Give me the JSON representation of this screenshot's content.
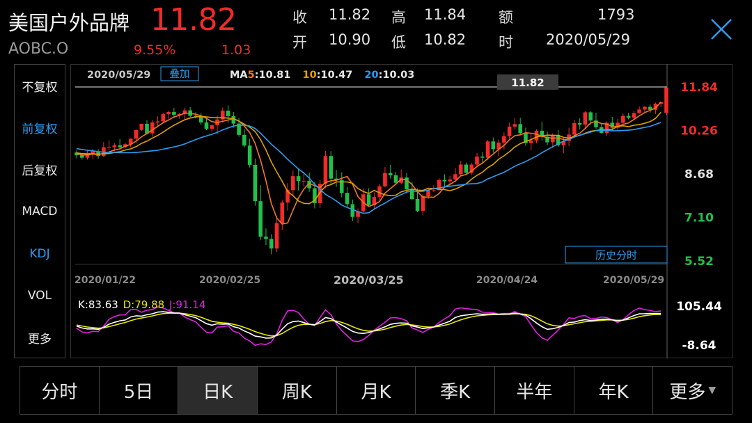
{
  "header": {
    "name": "美国户外品牌",
    "price": "11.82",
    "code": "AOBC.O",
    "change_pct": "9.55%",
    "change": "1.03",
    "stats": {
      "close_label": "收",
      "close": "11.82",
      "high_label": "高",
      "high": "11.84",
      "amount_label": "额",
      "amount": "1793",
      "open_label": "开",
      "open": "10.90",
      "low_label": "低",
      "low": "10.82",
      "time_label": "时",
      "date": "2020/05/29"
    }
  },
  "side_menu": {
    "items": [
      {
        "label": "不复权",
        "active": false
      },
      {
        "label": "前复权",
        "active": true
      },
      {
        "label": "后复权",
        "active": false
      },
      {
        "label": "MACD",
        "active": false
      },
      {
        "label": "KDJ",
        "active": true
      },
      {
        "label": "VOL",
        "active": false
      },
      {
        "label": "更多",
        "active": false
      }
    ]
  },
  "chart_data": {
    "type": "candlestick",
    "info_date": "2020/05/29",
    "overlay_button": "叠加",
    "ma": {
      "prefix": "MA",
      "items": [
        {
          "period": "5",
          "value": "10.81",
          "color": "#f07820"
        },
        {
          "period": "10",
          "value": "10.47",
          "color": "#e0a000"
        },
        {
          "period": "20",
          "value": "10.03",
          "color": "#2d9cf0"
        }
      ]
    },
    "price_axis": {
      "ticks": [
        "11.84",
        "10.26",
        "8.68",
        "7.10",
        "5.52"
      ],
      "tick_colors": [
        "#f42a2a",
        "#f42a2a",
        "#e0e0e0",
        "#22c04a",
        "#22c04a"
      ],
      "range": [
        5.52,
        11.84
      ]
    },
    "current_price_label": "11.82",
    "history_button": "历史分时",
    "date_labels": [
      "2020/01/22",
      "2020/02/25",
      "2020/03/25",
      "2020/04/24",
      "2020/05/29"
    ],
    "kdj": {
      "k_label": "K:83.63",
      "d_label": "D:79.88",
      "j_label": "J:91.14",
      "axis_ticks": [
        "105.44",
        "-8.64"
      ],
      "range": [
        -8.64,
        105.44
      ],
      "colors": {
        "K": "#ffffff",
        "D": "#e8e800",
        "J": "#e020e0"
      }
    },
    "colors": {
      "up": "#f42a2a",
      "down": "#22c04a"
    },
    "candles": [
      [
        9.46,
        9.55,
        9.25,
        9.36
      ],
      [
        9.36,
        9.43,
        9.2,
        9.27
      ],
      [
        9.27,
        9.56,
        9.2,
        9.42
      ],
      [
        9.42,
        9.59,
        9.24,
        9.5
      ],
      [
        9.5,
        9.58,
        9.23,
        9.33
      ],
      [
        9.33,
        9.84,
        9.29,
        9.65
      ],
      [
        9.65,
        9.9,
        9.53,
        9.65
      ],
      [
        9.65,
        9.79,
        9.5,
        9.72
      ],
      [
        9.72,
        9.95,
        9.6,
        9.65
      ],
      [
        9.65,
        9.81,
        9.62,
        9.76
      ],
      [
        9.76,
        9.97,
        9.66,
        9.96
      ],
      [
        9.96,
        10.29,
        9.82,
        10.28
      ],
      [
        10.28,
        10.51,
        10.24,
        10.5
      ],
      [
        10.5,
        10.63,
        10.11,
        10.15
      ],
      [
        10.15,
        10.64,
        10.03,
        10.55
      ],
      [
        10.55,
        10.77,
        10.42,
        10.59
      ],
      [
        10.59,
        10.91,
        10.54,
        10.85
      ],
      [
        10.85,
        10.98,
        10.69,
        10.93
      ],
      [
        10.93,
        11.08,
        10.71,
        10.83
      ],
      [
        10.83,
        10.9,
        10.69,
        10.86
      ],
      [
        10.86,
        11.09,
        10.65,
        10.99
      ],
      [
        10.99,
        11.11,
        10.74,
        10.79
      ],
      [
        10.79,
        10.92,
        10.7,
        10.77
      ],
      [
        10.77,
        10.89,
        10.46,
        10.55
      ],
      [
        10.55,
        10.68,
        10.27,
        10.32
      ],
      [
        10.32,
        10.47,
        10.22,
        10.45
      ],
      [
        10.45,
        10.8,
        10.13,
        10.66
      ],
      [
        10.66,
        11.09,
        10.54,
        10.98
      ],
      [
        10.98,
        11.17,
        10.54,
        10.78
      ],
      [
        10.78,
        10.93,
        10.36,
        10.51
      ],
      [
        10.51,
        10.71,
        10.03,
        10.1
      ],
      [
        10.1,
        10.31,
        9.64,
        9.71
      ],
      [
        9.71,
        9.96,
        8.91,
        9.01
      ],
      [
        9.01,
        9.24,
        7.53,
        7.69
      ],
      [
        7.69,
        8.27,
        6.27,
        6.4
      ],
      [
        6.4,
        6.7,
        6.1,
        6.32
      ],
      [
        6.32,
        6.49,
        5.76,
        5.97
      ],
      [
        5.97,
        7.14,
        5.85,
        6.89
      ],
      [
        6.89,
        7.73,
        6.64,
        7.64
      ],
      [
        7.64,
        8.35,
        7.35,
        8.09
      ],
      [
        8.09,
        8.81,
        7.89,
        8.6
      ],
      [
        8.6,
        8.86,
        8.08,
        8.42
      ],
      [
        8.42,
        8.76,
        8.24,
        8.43
      ],
      [
        8.43,
        8.73,
        8.03,
        8.16
      ],
      [
        8.16,
        8.38,
        7.43,
        7.62
      ],
      [
        7.62,
        8.47,
        7.45,
        8.32
      ],
      [
        8.32,
        9.52,
        8.16,
        9.33
      ],
      [
        9.33,
        9.51,
        8.28,
        8.51
      ],
      [
        8.51,
        8.83,
        8.21,
        8.46
      ],
      [
        8.46,
        8.74,
        7.83,
        7.99
      ],
      [
        7.99,
        8.2,
        7.46,
        7.58
      ],
      [
        7.58,
        7.75,
        6.96,
        7.12
      ],
      [
        7.12,
        7.43,
        6.91,
        7.32
      ],
      [
        7.32,
        8.16,
        7.28,
        7.94
      ],
      [
        7.94,
        8.16,
        7.49,
        7.55
      ],
      [
        7.55,
        8.01,
        7.39,
        7.84
      ],
      [
        7.84,
        8.32,
        7.73,
        8.23
      ],
      [
        8.23,
        8.93,
        8.19,
        8.71
      ],
      [
        8.71,
        9.01,
        8.51,
        8.63
      ],
      [
        8.63,
        8.75,
        8.33,
        8.36
      ],
      [
        8.36,
        8.84,
        8.31,
        8.55
      ],
      [
        8.55,
        8.71,
        7.98,
        8.12
      ],
      [
        8.12,
        8.4,
        7.72,
        7.77
      ],
      [
        7.77,
        8.15,
        7.29,
        7.34
      ],
      [
        7.34,
        7.96,
        7.17,
        7.87
      ],
      [
        7.87,
        8.14,
        7.77,
        8.08
      ],
      [
        8.08,
        8.27,
        8.03,
        8.09
      ],
      [
        8.09,
        8.52,
        8.07,
        8.46
      ],
      [
        8.46,
        8.67,
        8.23,
        8.41
      ],
      [
        8.41,
        8.62,
        8.22,
        8.48
      ],
      [
        8.48,
        8.9,
        8.38,
        8.67
      ],
      [
        8.67,
        9.15,
        8.61,
        9.02
      ],
      [
        9.02,
        9.1,
        8.66,
        8.72
      ],
      [
        8.72,
        9.08,
        8.64,
        9.02
      ],
      [
        9.02,
        9.44,
        8.97,
        9.31
      ],
      [
        9.31,
        9.48,
        9.06,
        9.27
      ],
      [
        9.27,
        9.92,
        9.19,
        9.86
      ],
      [
        9.86,
        10.0,
        9.45,
        9.58
      ],
      [
        9.58,
        9.93,
        9.34,
        9.82
      ],
      [
        9.82,
        10.19,
        9.57,
        10.05
      ],
      [
        10.05,
        10.55,
        9.96,
        10.4
      ],
      [
        10.4,
        10.71,
        10.29,
        10.49
      ],
      [
        10.49,
        10.72,
        10.1,
        10.16
      ],
      [
        10.16,
        10.36,
        9.7,
        9.8
      ],
      [
        9.8,
        10.12,
        9.53,
        9.89
      ],
      [
        9.89,
        10.3,
        9.79,
        10.25
      ],
      [
        10.25,
        10.58,
        9.89,
        10.03
      ],
      [
        10.03,
        10.22,
        9.73,
        9.83
      ],
      [
        9.83,
        10.16,
        9.62,
        10.1
      ],
      [
        10.1,
        10.27,
        9.67,
        9.72
      ],
      [
        9.72,
        9.99,
        9.43,
        9.88
      ],
      [
        9.88,
        10.36,
        9.69,
        10.11
      ],
      [
        10.11,
        10.65,
        10.01,
        10.53
      ],
      [
        10.53,
        10.7,
        10.29,
        10.47
      ],
      [
        10.47,
        10.96,
        10.37,
        10.92
      ],
      [
        10.92,
        10.97,
        10.47,
        10.62
      ],
      [
        10.62,
        10.9,
        10.32,
        10.38
      ],
      [
        10.38,
        10.54,
        10.14,
        10.17
      ],
      [
        10.17,
        10.59,
        10.06,
        10.54
      ],
      [
        10.54,
        10.75,
        10.26,
        10.36
      ],
      [
        10.36,
        10.69,
        10.27,
        10.54
      ],
      [
        10.54,
        10.88,
        10.47,
        10.79
      ],
      [
        10.79,
        10.9,
        10.66,
        10.72
      ],
      [
        10.72,
        10.98,
        10.67,
        10.89
      ],
      [
        10.89,
        11.13,
        10.86,
        11.02
      ],
      [
        11.02,
        11.14,
        10.92,
        11.12
      ],
      [
        11.12,
        11.21,
        10.9,
        11.01
      ],
      [
        11.01,
        11.27,
        10.86,
        11.23
      ],
      [
        11.23,
        11.3,
        11.11,
        11.29
      ],
      [
        10.9,
        11.84,
        10.82,
        11.82
      ]
    ],
    "ma5": [
      9.42,
      9.37,
      9.37,
      9.4,
      9.38,
      9.43,
      9.48,
      9.55,
      9.59,
      9.69,
      9.75,
      9.87,
      10.03,
      10.15,
      10.28,
      10.41,
      10.54,
      10.64,
      10.75,
      10.81,
      10.89,
      10.88,
      10.85,
      10.79,
      10.7,
      10.58,
      10.55,
      10.59,
      10.64,
      10.68,
      10.61,
      10.42,
      10.18,
      9.79,
      9.18,
      8.43,
      7.6,
      7.08,
      6.86,
      6.9,
      7.36,
      7.81,
      8.13,
      8.34,
      8.25,
      8.19,
      8.37,
      8.43,
      8.45,
      8.52,
      8.59,
      8.31,
      7.86,
      7.64,
      7.5,
      7.57,
      7.68,
      7.98,
      8.15,
      8.31,
      8.49,
      8.47,
      8.29,
      8.03,
      7.84,
      7.84,
      7.83,
      7.97,
      8.2,
      8.3,
      8.42,
      8.61,
      8.66,
      8.78,
      8.95,
      9.07,
      9.24,
      9.4,
      9.57,
      9.72,
      9.92,
      10.07,
      10.1,
      10.18,
      10.16,
      10.12,
      10.05,
      10.0,
      9.98,
      9.99,
      9.93,
      9.93,
      10.07,
      10.16,
      10.33,
      10.53,
      10.59,
      10.51,
      10.49,
      10.41,
      10.4,
      10.48,
      10.53,
      10.66,
      10.79,
      10.91,
      10.99,
      11.08,
      11.29
    ],
    "ma10": [
      9.44,
      9.42,
      9.41,
      9.41,
      9.4,
      9.41,
      9.42,
      9.46,
      9.49,
      9.55,
      9.59,
      9.67,
      9.79,
      9.87,
      9.98,
      10.08,
      10.2,
      10.33,
      10.45,
      10.55,
      10.65,
      10.71,
      10.75,
      10.77,
      10.75,
      10.73,
      10.72,
      10.72,
      10.71,
      10.69,
      10.6,
      10.49,
      10.38,
      10.22,
      9.93,
      9.55,
      9.11,
      8.75,
      8.41,
      8.04,
      7.89,
      7.7,
      7.61,
      7.6,
      7.72,
      8.01,
      8.23,
      8.29,
      8.39,
      8.39,
      8.39,
      8.34,
      8.15,
      8.04,
      7.97,
      8.08,
      7.99,
      7.92,
      7.89,
      7.91,
      8.03,
      8.08,
      8.13,
      8.09,
      8.08,
      8.16,
      8.15,
      8.13,
      8.11,
      8.07,
      8.13,
      8.22,
      8.32,
      8.49,
      8.63,
      8.74,
      8.91,
      9.03,
      9.21,
      9.34,
      9.49,
      9.66,
      9.78,
      9.86,
      9.93,
      10.02,
      10.06,
      10.09,
      10.08,
      10.08,
      10.01,
      9.98,
      10.04,
      10.08,
      10.16,
      10.23,
      10.26,
      10.29,
      10.28,
      10.3,
      10.41,
      10.43,
      10.4,
      10.45,
      10.47,
      10.52,
      10.58,
      10.7,
      10.92
    ],
    "ma20": [
      9.6,
      9.57,
      9.54,
      9.52,
      9.49,
      9.47,
      9.46,
      9.46,
      9.45,
      9.45,
      9.45,
      9.46,
      9.48,
      9.5,
      9.52,
      9.54,
      9.58,
      9.62,
      9.66,
      9.71,
      9.77,
      9.85,
      9.93,
      10.0,
      10.06,
      10.12,
      10.19,
      10.28,
      10.35,
      10.42,
      10.45,
      10.45,
      10.42,
      10.33,
      10.16,
      9.96,
      9.76,
      9.59,
      9.41,
      9.21,
      9.04,
      8.86,
      8.71,
      8.53,
      8.3,
      8.12,
      7.94,
      7.82,
      7.7,
      7.55,
      7.46,
      7.39,
      7.31,
      7.25,
      7.27,
      7.4,
      7.52,
      7.62,
      7.74,
      7.84,
      7.93,
      8.02,
      8.06,
      8.04,
      8.05,
      8.09,
      8.15,
      8.17,
      8.21,
      8.23,
      8.26,
      8.28,
      8.31,
      8.32,
      8.33,
      8.39,
      8.5,
      8.58,
      8.66,
      8.74,
      8.85,
      8.96,
      9.05,
      9.13,
      9.23,
      9.33,
      9.45,
      9.56,
      9.67,
      9.77,
      9.87,
      9.93,
      10.02,
      10.09,
      10.14,
      10.2,
      10.25,
      10.27,
      10.26,
      10.25,
      10.25,
      10.26,
      10.27,
      10.29,
      10.33,
      10.37,
      10.41,
      10.48,
      10.55
    ],
    "k": [
      45.95,
      40.27,
      37.33,
      37.68,
      36.22,
      42.25,
      51.55,
      57.13,
      61.65,
      64.19,
      73.08,
      76.53,
      75.48,
      79.78,
      82.58,
      87.69,
      88.67,
      87.13,
      84.92,
      84.73,
      79.56,
      75.32,
      71.02,
      62.38,
      53.18,
      48.6,
      52.78,
      51.77,
      52.04,
      44.19,
      40.07,
      31.35,
      24.59,
      15.97,
      13.82,
      9.95,
      10.56,
      19.32,
      37.08,
      52.88,
      59.17,
      61.12,
      56.24,
      51.37,
      49.4,
      59.58,
      71.12,
      68.25,
      58.25,
      48.78,
      39.93,
      30.14,
      25.09,
      24.16,
      26.62,
      32.05,
      37.43,
      43.55,
      51.11,
      54.22,
      55.33,
      54.54,
      46.28,
      42.9,
      38.47,
      40.8,
      43.17,
      48.82,
      54.46,
      60.66,
      71.38,
      76.52,
      78.86,
      80.91,
      82.67,
      81.07,
      81.75,
      82.13,
      80.98,
      81.74,
      81.92,
      84.6,
      82.03,
      78.54,
      67.63,
      55.03,
      44.31,
      36.39,
      38.09,
      41.89,
      48.25,
      56.74,
      58.04,
      62.4,
      65.09,
      62.85,
      63.84,
      66.43,
      66.71,
      64.42,
      60.99,
      63.97,
      70.34,
      77.15,
      82.47,
      82.83,
      83.71,
      83.24,
      83.63
    ],
    "d": [
      49.03,
      46.11,
      43.18,
      41.35,
      39.64,
      40.51,
      44.19,
      48.5,
      52.88,
      56.65,
      62.13,
      66.93,
      69.78,
      73.11,
      76.27,
      80.07,
      82.94,
      84.34,
      84.54,
      84.6,
      82.92,
      80.39,
      77.27,
      72.3,
      65.93,
      60.15,
      57.69,
      55.72,
      54.49,
      51.06,
      47.39,
      42.05,
      36.23,
      29.48,
      24.26,
      19.49,
      16.51,
      17.45,
      23.99,
      33.62,
      42.14,
      48.47,
      51.06,
      51.16,
      50.57,
      53.58,
      59.43,
      62.37,
      60.99,
      56.92,
      51.26,
      44.22,
      37.84,
      33.28,
      31.06,
      31.39,
      33.4,
      36.79,
      41.56,
      45.78,
      48.97,
      50.83,
      49.31,
      47.17,
      44.27,
      43.11,
      43.13,
      45.03,
      48.17,
      52.34,
      58.68,
      64.63,
      69.37,
      73.22,
      76.37,
      77.94,
      79.21,
      80.18,
      80.45,
      80.88,
      81.23,
      82.35,
      82.24,
      81.01,
      76.55,
      69.38,
      61.02,
      52.81,
      47.9,
      45.9,
      46.68,
      50.04,
      52.71,
      55.94,
      58.99,
      60.28,
      61.47,
      63.12,
      64.32,
      64.35,
      63.23,
      63.48,
      65.77,
      69.56,
      73.86,
      76.85,
      79.14,
      80.51,
      79.88
    ],
    "j": [
      39.79,
      28.59,
      25.63,
      30.34,
      29.38,
      45.73,
      66.27,
      74.39,
      79.19,
      79.27,
      94.98,
      95.73,
      86.88,
      93.12,
      95.2,
      102.93,
      100.13,
      92.71,
      85.68,
      84.99,
      72.84,
      65.18,
      58.52,
      42.54,
      27.68,
      25.5,
      42.96,
      43.87,
      47.14,
      30.45,
      25.43,
      9.95,
      1.31,
      -11.1,
      -7.06,
      -9.13,
      -1.34,
      23.06,
      63.26,
      91.4,
      93.23,
      86.42,
      66.6,
      51.79,
      47.06,
      71.58,
      94.5,
      80.01,
      52.77,
      32.5,
      17.27,
      1.98,
      -0.41,
      5.92,
      17.74,
      33.37,
      45.49,
      57.07,
      70.21,
      71.1,
      68.05,
      61.96,
      40.22,
      34.36,
      26.87,
      36.18,
      43.25,
      56.4,
      67.04,
      77.3,
      96.78,
      100.3,
      97.84,
      96.29,
      95.27,
      87.33,
      86.83,
      86.03,
      82.04,
      83.46,
      83.3,
      89.1,
      81.61,
      73.6,
      49.79,
      26.33,
      10.89,
      3.55,
      18.47,
      33.87,
      51.39,
      70.14,
      68.7,
      75.32,
      77.29,
      67.99,
      68.58,
      73.05,
      71.49,
      64.56,
      56.51,
      64.95,
      79.48,
      92.33,
      99.69,
      94.79,
      92.85,
      88.7,
      91.14
    ]
  },
  "tabs": [
    {
      "label": "分时",
      "active": false
    },
    {
      "label": "5日",
      "active": false
    },
    {
      "label": "日K",
      "active": true
    },
    {
      "label": "周K",
      "active": false
    },
    {
      "label": "月K",
      "active": false
    },
    {
      "label": "季K",
      "active": false
    },
    {
      "label": "半年",
      "active": false
    },
    {
      "label": "年K",
      "active": false
    },
    {
      "label": "更多",
      "active": false,
      "has_caret": true
    }
  ]
}
